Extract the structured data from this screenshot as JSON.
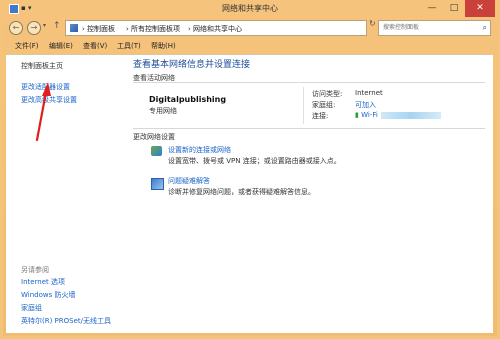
{
  "window": {
    "title": "网络和共享中心",
    "minimize": "—",
    "maximize": "□",
    "close": "✕"
  },
  "nav": {
    "back": "←",
    "forward": "→",
    "dropdown": "▾",
    "up": "↑",
    "refresh": "↻",
    "address_dropdown": "▾"
  },
  "breadcrumb": [
    "› 控制面板",
    "› 所有控制面板项",
    "› 网络和共享中心"
  ],
  "search": {
    "placeholder": "搜索控制面板",
    "icon": "search-icon"
  },
  "menubar": [
    "文件(F)",
    "编辑(E)",
    "查看(V)",
    "工具(T)",
    "帮助(H)"
  ],
  "sidebar": {
    "top_links": [
      "控制面板主页",
      "更改适配器设置",
      "更改高级共享设置"
    ],
    "see_also_title": "另请参阅",
    "see_also": [
      "Internet 选项",
      "Windows 防火墙",
      "家庭组",
      "英特尔(R) PROSet/无线工具"
    ]
  },
  "main": {
    "heading": "查看基本网络信息并设置连接",
    "active_section": "查看活动网络",
    "network_name": "Digitalpublishing",
    "network_type": "专用网络",
    "access_type_label": "访问类型:",
    "access_type_value": "Internet",
    "homegroup_label": "家庭组:",
    "homegroup_value": "可加入",
    "connection_label": "连接:",
    "connection_value": "Wi-Fi",
    "change_section": "更改网络设置",
    "tasks": [
      {
        "link": "设置新的连接或网络",
        "desc": "设置宽带、拨号或 VPN 连接；或设置路由器或接入点。"
      },
      {
        "link": "问题疑难解答",
        "desc": "诊断并修复网络问题，或者获得疑难解答信息。"
      }
    ]
  },
  "colors": {
    "frame": "#f3c47a",
    "link": "#1a64c8",
    "heading": "#1e4e9a",
    "close_button": "#c9413a",
    "annotation_arrow": "#e02020"
  }
}
